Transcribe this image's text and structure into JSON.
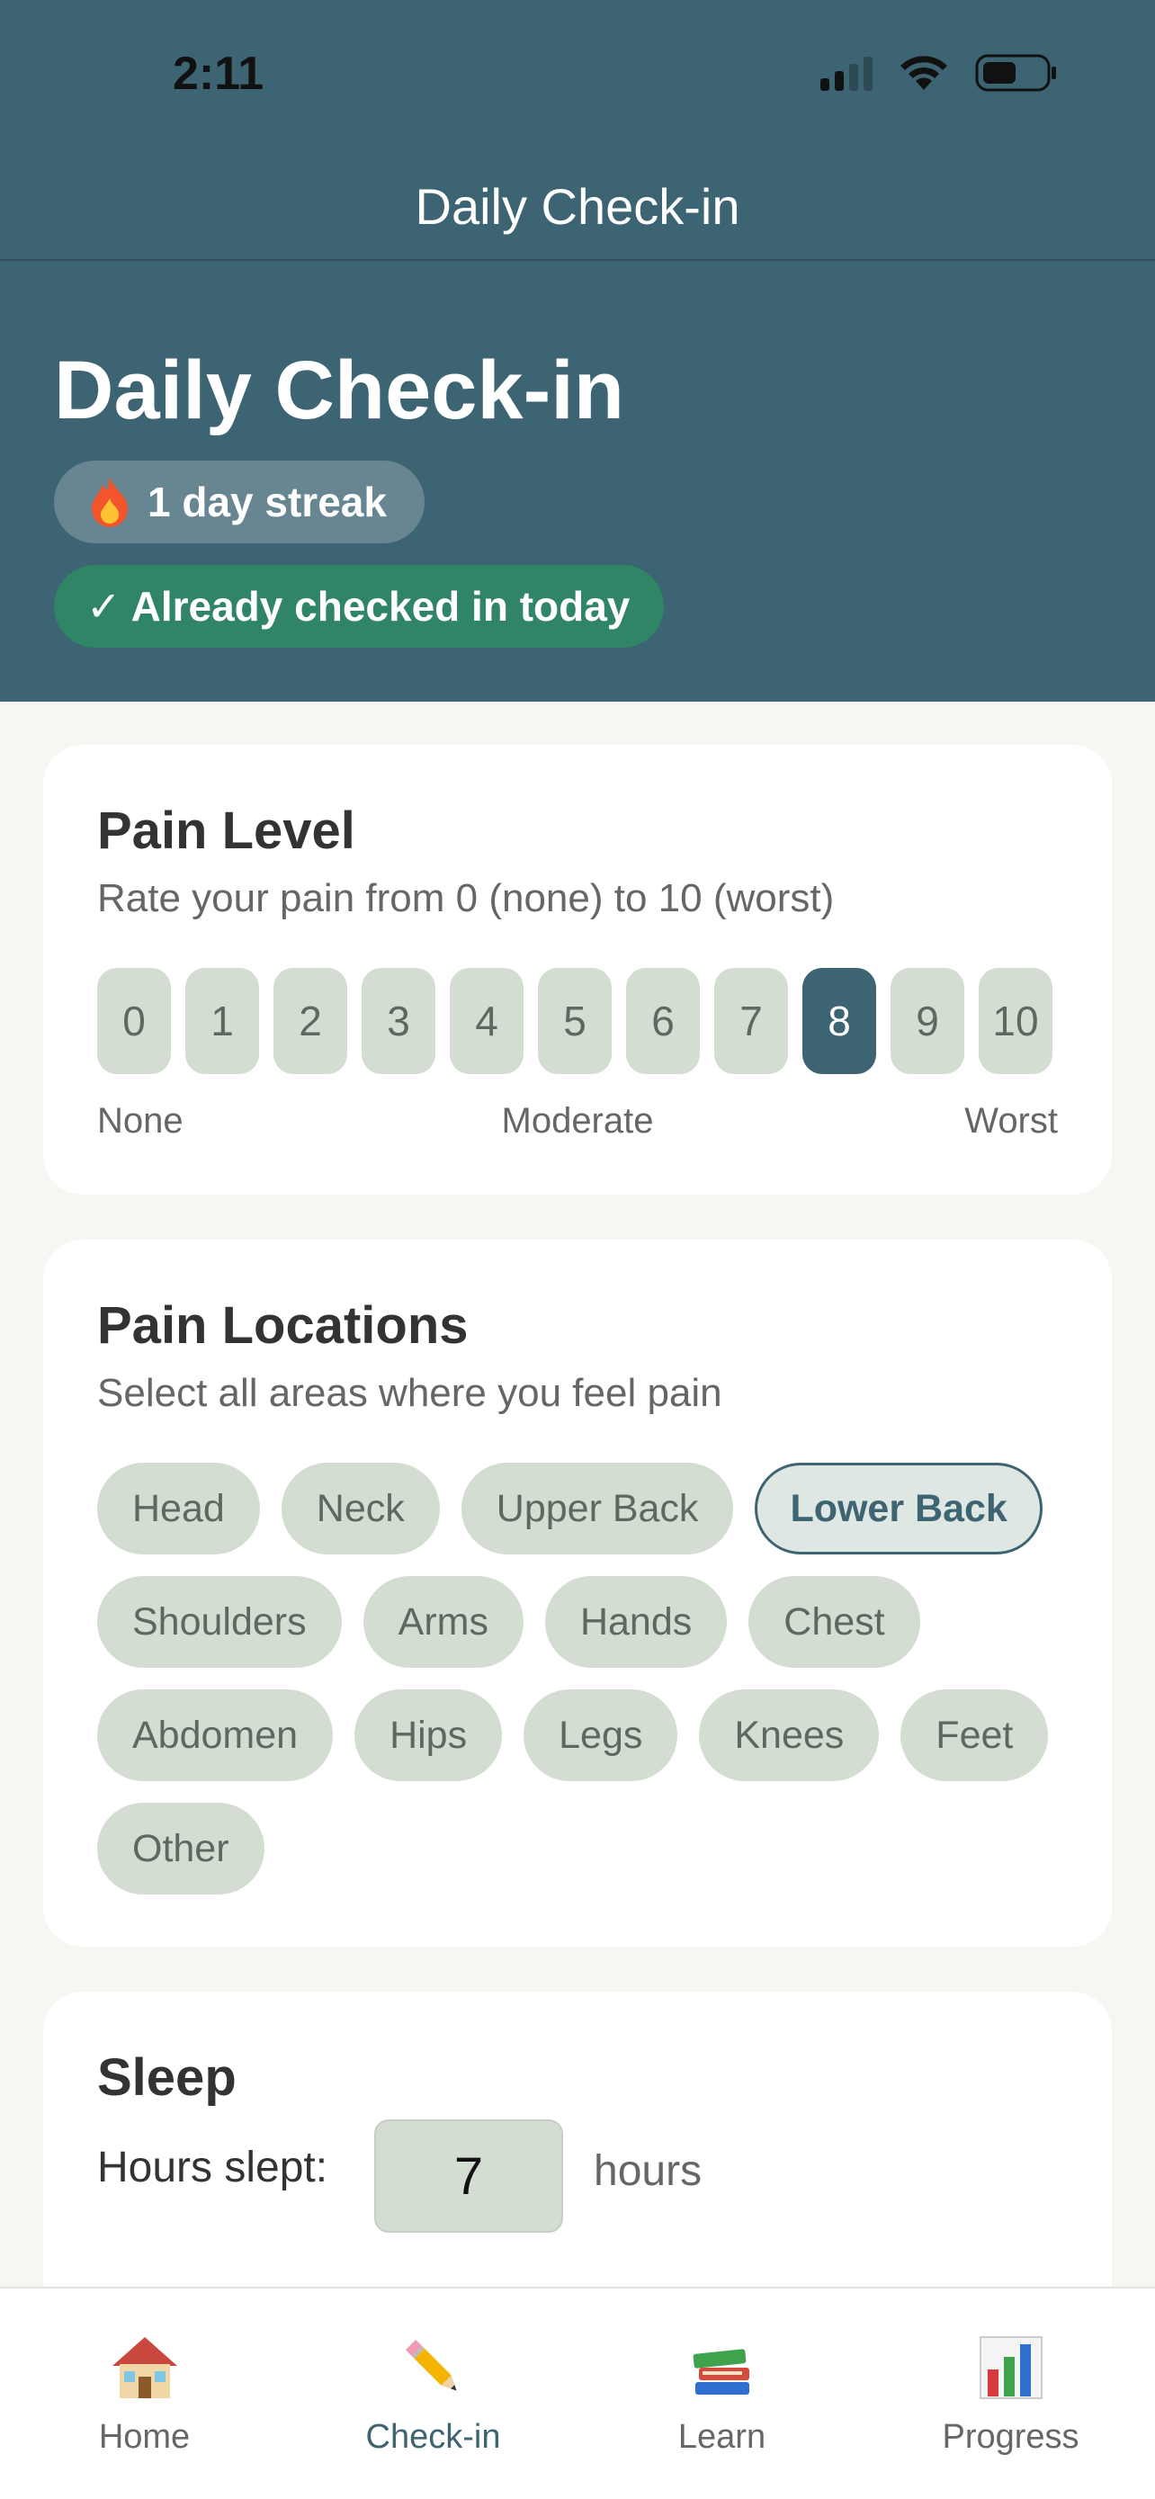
{
  "status_bar": {
    "time": "2:11"
  },
  "nav": {
    "title": "Daily Check-in"
  },
  "header": {
    "title": "Daily Check-in",
    "streak": "1 day streak",
    "checked_in": "✓ Already checked in today"
  },
  "pain_level": {
    "title": "Pain Level",
    "subtitle": "Rate your pain from 0 (none) to 10 (worst)",
    "options": [
      "0",
      "1",
      "2",
      "3",
      "4",
      "5",
      "6",
      "7",
      "8",
      "9",
      "10"
    ],
    "selected": "8",
    "labels": {
      "low": "None",
      "mid": "Moderate",
      "high": "Worst"
    }
  },
  "pain_locations": {
    "title": "Pain Locations",
    "subtitle": "Select all areas where you feel pain",
    "chips": [
      "Head",
      "Neck",
      "Upper Back",
      "Lower Back",
      "Shoulders",
      "Arms",
      "Hands",
      "Chest",
      "Abdomen",
      "Hips",
      "Legs",
      "Knees",
      "Feet",
      "Other"
    ],
    "selected": [
      "Lower Back"
    ]
  },
  "sleep": {
    "title": "Sleep",
    "hours_label": "Hours slept:",
    "hours_value": "7",
    "unit": "hours"
  },
  "tabs": [
    {
      "label": "Home",
      "icon": "house-icon"
    },
    {
      "label": "Check-in",
      "icon": "pencil-icon",
      "active": true
    },
    {
      "label": "Learn",
      "icon": "books-icon"
    },
    {
      "label": "Progress",
      "icon": "bar-chart-icon"
    }
  ],
  "colors": {
    "primary": "#3d6472",
    "success": "#2f8566",
    "chip": "#d4ddd2",
    "background": "#f7f6f2"
  }
}
